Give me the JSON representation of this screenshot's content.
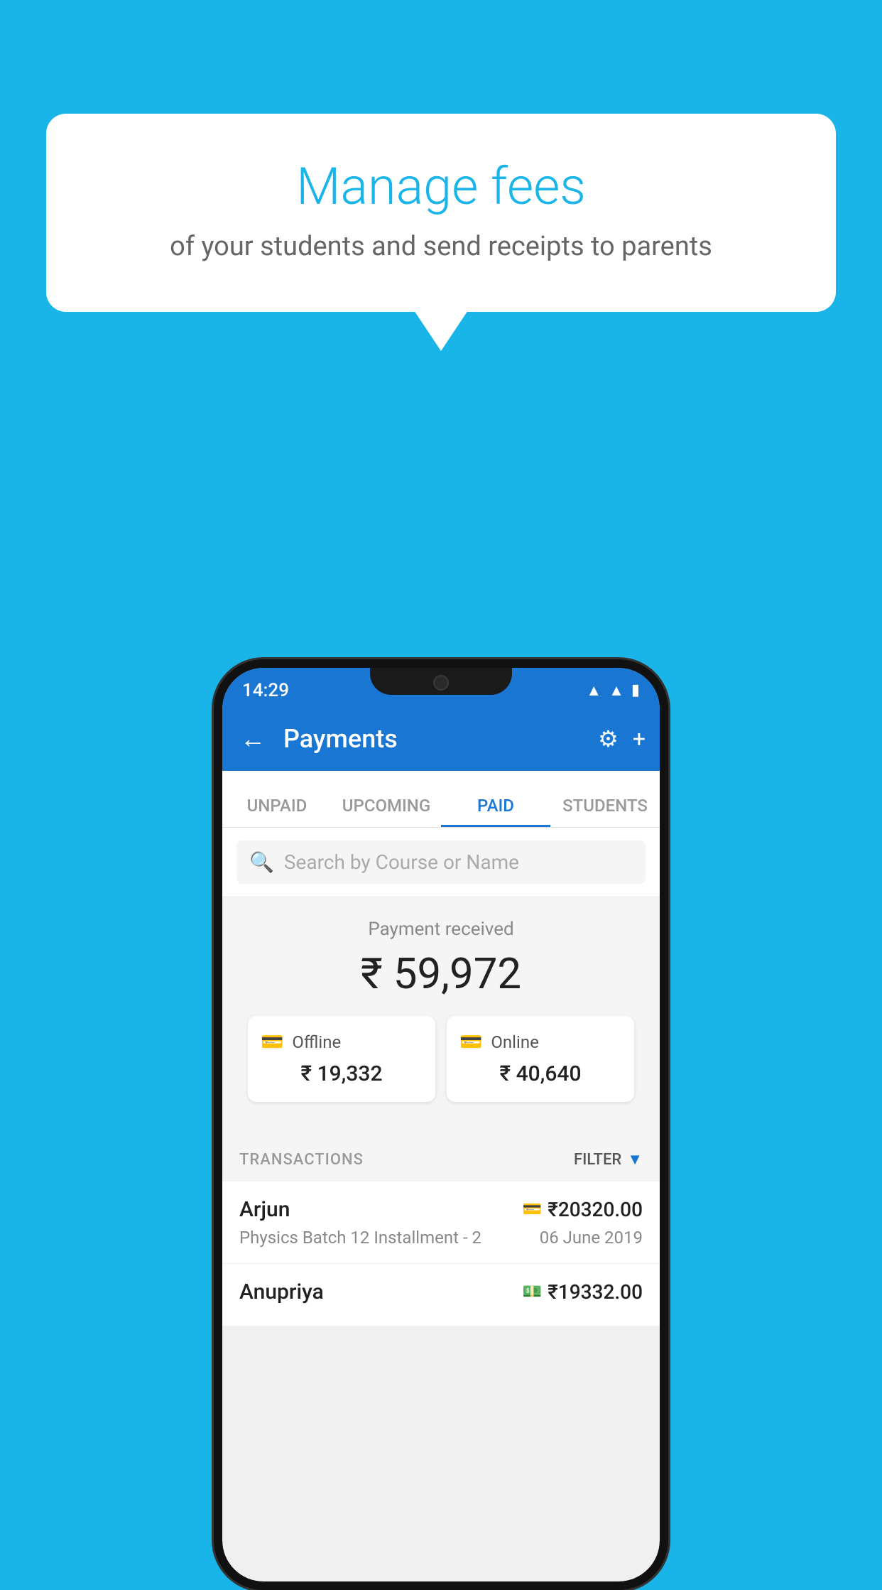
{
  "background_color": "#1ab5e8",
  "bubble": {
    "title": "Manage fees",
    "subtitle": "of your students and send receipts to parents"
  },
  "status_bar": {
    "time": "14:29",
    "wifi_symbol": "▲",
    "signal_symbol": "▲",
    "battery_symbol": "▮"
  },
  "header": {
    "back_icon": "←",
    "title": "Payments",
    "gear_icon": "⚙",
    "plus_icon": "+"
  },
  "tabs": [
    {
      "label": "UNPAID",
      "active": false
    },
    {
      "label": "UPCOMING",
      "active": false
    },
    {
      "label": "PAID",
      "active": true
    },
    {
      "label": "STUDENTS",
      "active": false
    }
  ],
  "search": {
    "placeholder": "Search by Course or Name",
    "icon": "🔍"
  },
  "payment_summary": {
    "label": "Payment received",
    "amount": "₹ 59,972",
    "offline_label": "Offline",
    "offline_amount": "₹ 19,332",
    "online_label": "Online",
    "online_amount": "₹ 40,640"
  },
  "transactions": {
    "header_label": "TRANSACTIONS",
    "filter_label": "FILTER",
    "items": [
      {
        "name": "Arjun",
        "amount": "₹20320.00",
        "payment_type": "card",
        "description": "Physics Batch 12 Installment - 2",
        "date": "06 June 2019"
      },
      {
        "name": "Anupriya",
        "amount": "₹19332.00",
        "payment_type": "cash",
        "description": "",
        "date": ""
      }
    ]
  }
}
